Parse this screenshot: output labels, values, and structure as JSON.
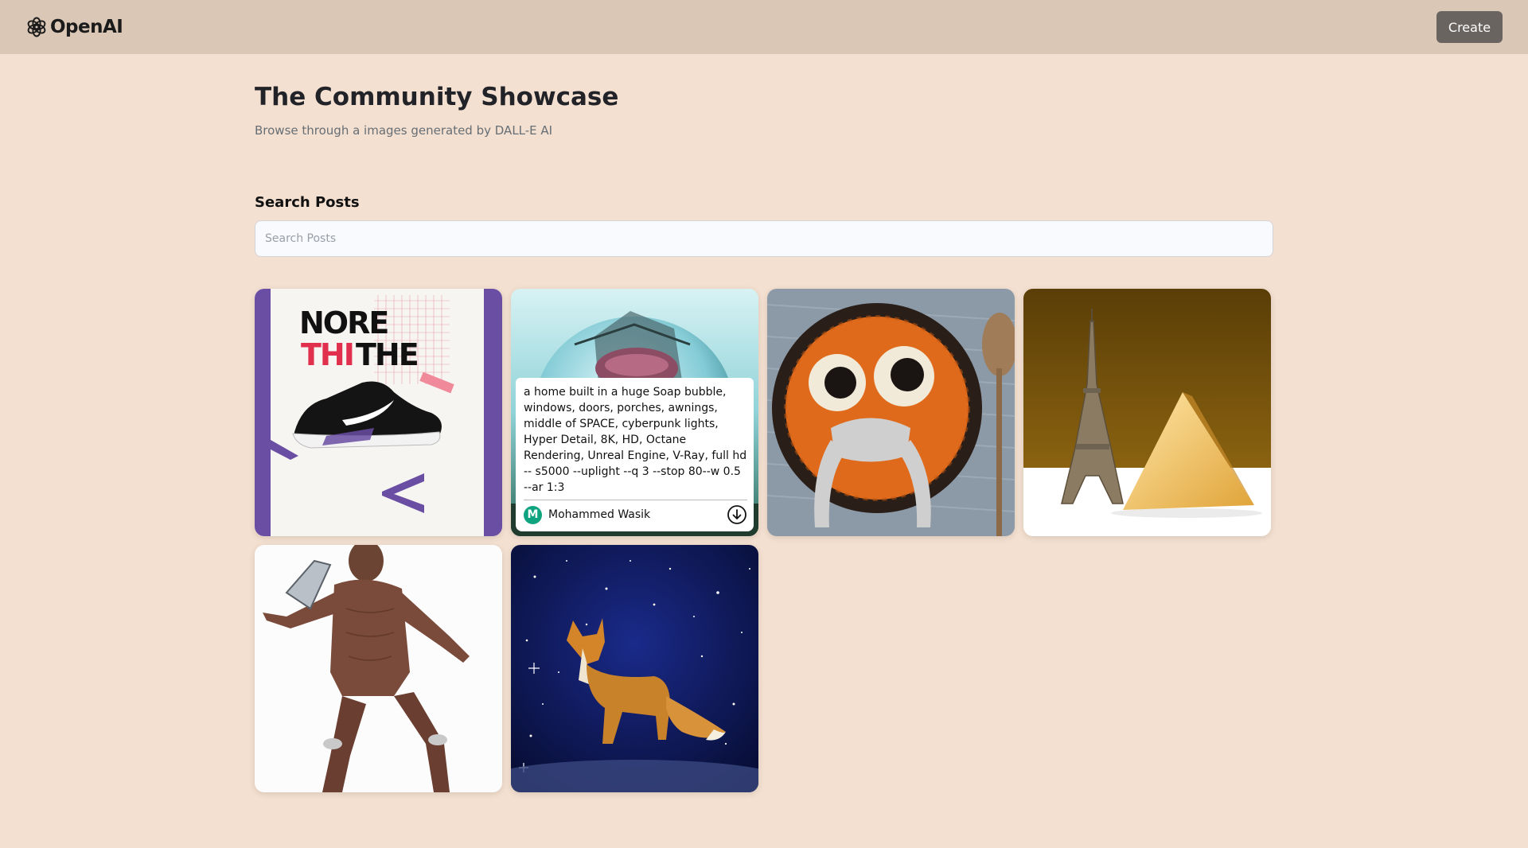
{
  "header": {
    "brand": "OpenAI",
    "logo_icon": "openai-logo-icon",
    "create_label": "Create"
  },
  "main": {
    "title": "The Community Showcase",
    "subtitle": "Browse through a images generated by DALL-E AI",
    "search_label": "Search Posts",
    "search_placeholder": "Search Posts",
    "search_value": ""
  },
  "posts": [
    {
      "image": "sneaker-poster-image",
      "subject": "NORE THITHE"
    },
    {
      "image": "soap-bubble-house-image",
      "prompt": "a home built in a huge Soap bubble, windows, doors, porches, awnings, middle of SPACE, cyberpunk lights, Hyper Detail, 8K, HD, Octane Rendering, Unreal Engine, V-Ray, full hd -- s5000 --uplight --q 3 --stop 80--w 0.5 --ar 1:3",
      "author": "Mohammed Wasik",
      "author_initial": "M",
      "action_icon": "download-icon"
    },
    {
      "image": "knitted-owl-soup-image"
    },
    {
      "image": "eiffel-tower-pyramid-image"
    },
    {
      "image": "iron-man-figure-image"
    },
    {
      "image": "fox-in-space-image"
    }
  ],
  "colors": {
    "page_bg": "#f4e0d0",
    "header_bg": "#dbc7b5",
    "button_bg": "#6a6460",
    "avatar_bg": "#10a37f"
  }
}
